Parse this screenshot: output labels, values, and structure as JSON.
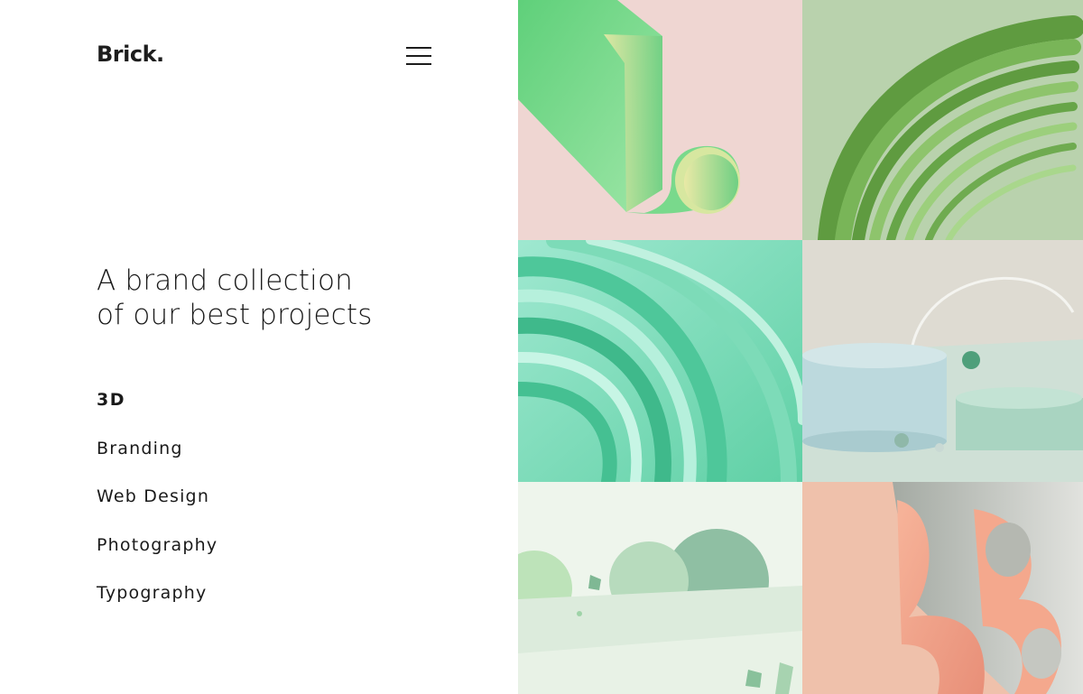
{
  "header": {
    "logo": "Brick.",
    "menu_icon": "hamburger-menu-icon"
  },
  "hero": {
    "line1": "A brand collection",
    "line2": "of our best projects"
  },
  "categories": [
    {
      "label": "3D",
      "active": true
    },
    {
      "label": "Branding",
      "active": false
    },
    {
      "label": "Web Design",
      "active": false
    },
    {
      "label": "Photography",
      "active": false
    },
    {
      "label": "Typography",
      "active": false
    }
  ],
  "gallery": {
    "tiles": [
      {
        "subject": "green folded ribbon on pink",
        "background": "#efd6d2",
        "accent": "#6fd68a"
      },
      {
        "subject": "green layered rings",
        "background": "#b9d2ad",
        "accent": "#6aa94d"
      },
      {
        "subject": "mint swirling tubes",
        "background": "#8fe0c2",
        "accent": "#4fc9a0"
      },
      {
        "subject": "pastel podiums with spheres",
        "background": "#dedbd2",
        "accent": "#b7d8dc"
      },
      {
        "subject": "mint arches and crystals",
        "background": "#e2efe0",
        "accent": "#9fcf9e"
      },
      {
        "subject": "peach ribbon letterform",
        "background": "#f0c3ad",
        "accent": "#f2a58a"
      }
    ]
  }
}
